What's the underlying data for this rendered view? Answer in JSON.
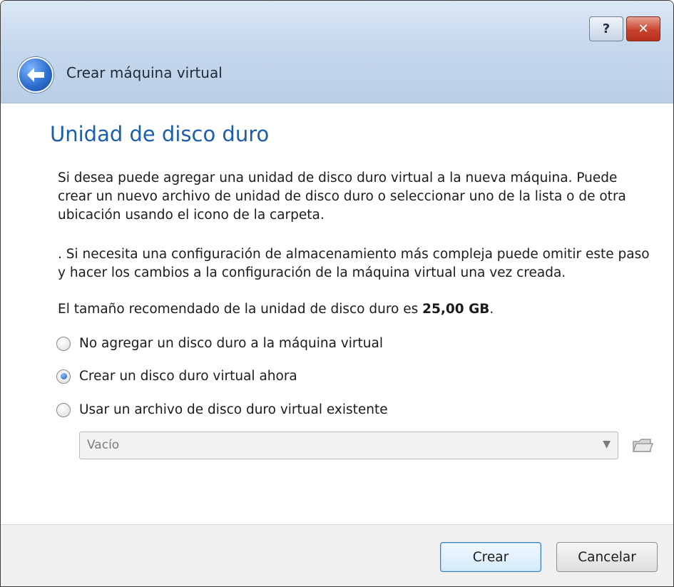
{
  "window": {
    "title": "Crear máquina virtual",
    "help_button": "?",
    "close_button": "✕"
  },
  "page": {
    "heading": "Unidad de disco duro",
    "paragraph1": "Si desea puede agregar una unidad de disco duro virtual a la nueva máquina. Puede crear un nuevo archivo de unidad de disco duro o seleccionar uno de la lista o de otra ubicación usando el icono de la carpeta.",
    "paragraph2": ". Si necesita una configuración de almacenamiento más compleja puede omitir este paso y hacer los cambios a la configuración de la máquina virtual una vez creada.",
    "recommended_prefix": "El tamaño recomendado de la unidad de disco duro es ",
    "recommended_size": "25,00 GB",
    "recommended_suffix": "."
  },
  "options": [
    {
      "label": "No agregar un disco duro a la máquina virtual",
      "selected": false
    },
    {
      "label": "Crear un disco duro virtual ahora",
      "selected": true
    },
    {
      "label": "Usar un archivo de disco duro virtual existente",
      "selected": false
    }
  ],
  "existing_disk": {
    "value": "Vacío",
    "enabled": false,
    "icon": "folder-open-icon"
  },
  "footer": {
    "create_label": "Crear",
    "cancel_label": "Cancelar"
  },
  "colors": {
    "heading": "#1d5ea8",
    "titlebar": "#c6d8ec",
    "close": "#c8432e",
    "primary_border": "#3c7fb1"
  }
}
